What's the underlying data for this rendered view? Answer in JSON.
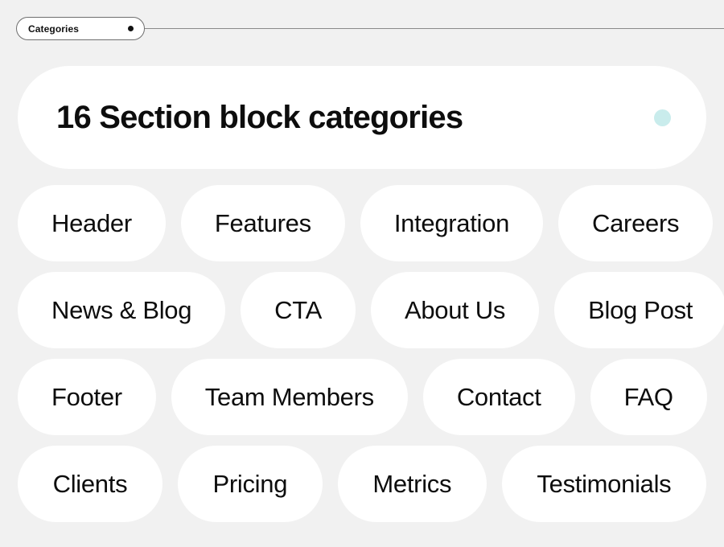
{
  "annotation": {
    "tag_label": "Categories",
    "dot_icon": "filled-dot-icon",
    "dot_color": "#111111",
    "line_color": "#8a8a8a"
  },
  "title_card": {
    "title": "16 Section block categories",
    "accent_dot_icon": "accent-dot-icon",
    "accent_color": "#c9ecec",
    "background": "#ffffff"
  },
  "theme": {
    "page_background": "#f1f1f1",
    "card_background": "#ffffff",
    "text_color": "#0d0d0d"
  },
  "categories": {
    "count": 16,
    "rows": [
      [
        {
          "label": "Header"
        },
        {
          "label": "Features"
        },
        {
          "label": "Integration"
        },
        {
          "label": "Careers"
        }
      ],
      [
        {
          "label": "News & Blog"
        },
        {
          "label": "CTA"
        },
        {
          "label": "About Us"
        },
        {
          "label": "Blog Post"
        }
      ],
      [
        {
          "label": "Footer"
        },
        {
          "label": "Team Members"
        },
        {
          "label": "Contact"
        },
        {
          "label": "FAQ"
        }
      ],
      [
        {
          "label": "Clients"
        },
        {
          "label": "Pricing"
        },
        {
          "label": "Metrics"
        },
        {
          "label": "Testimonials"
        }
      ]
    ]
  }
}
